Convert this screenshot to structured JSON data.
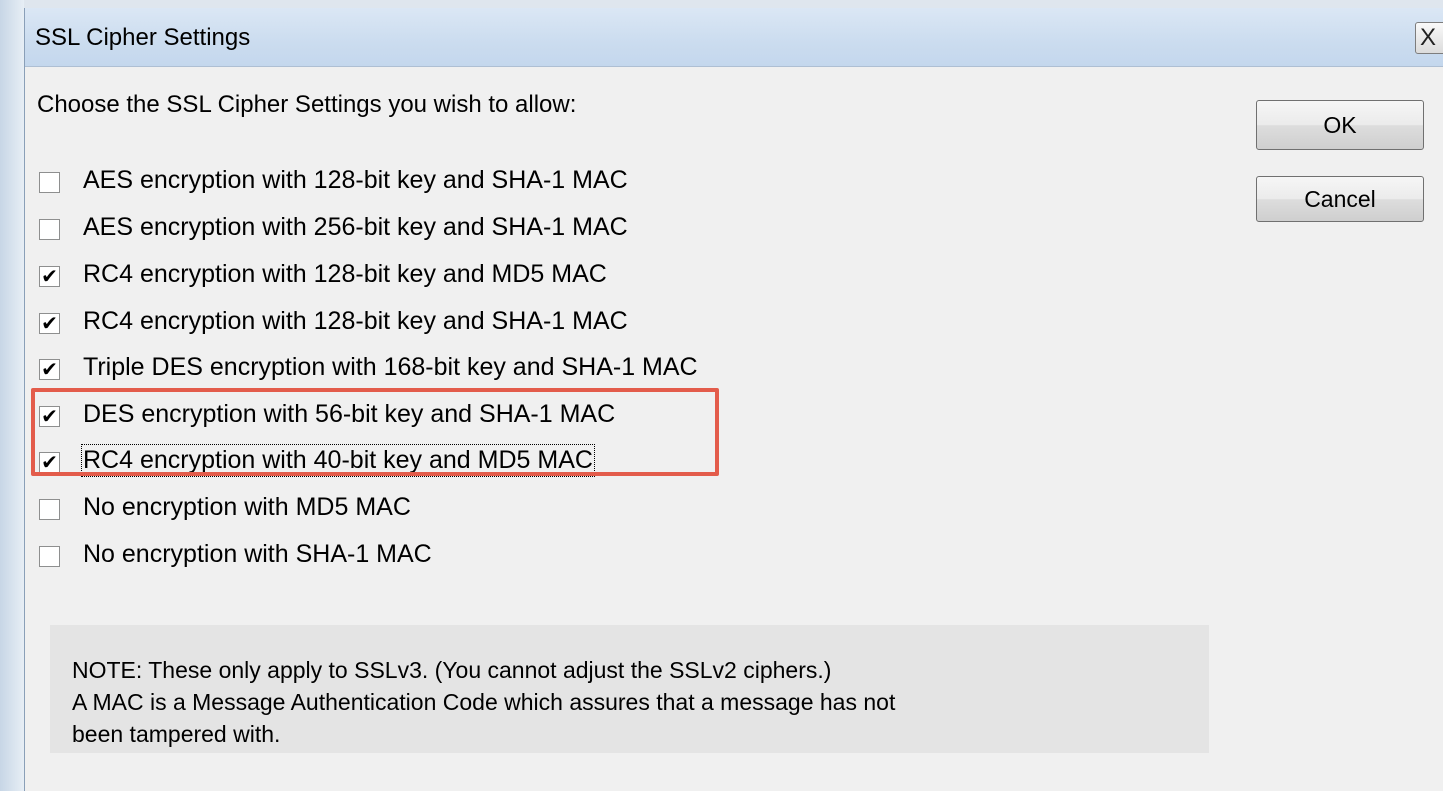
{
  "dialog": {
    "title": "SSL Cipher Settings",
    "close_glyph": "X",
    "prompt": "Choose the SSL Cipher Settings you wish to allow:",
    "ok_label": "OK",
    "cancel_label": "Cancel"
  },
  "ciphers": [
    {
      "label": "AES encryption with 128-bit key and SHA-1 MAC",
      "checked": false,
      "glyph": ""
    },
    {
      "label": "AES encryption with 256-bit key and SHA-1 MAC",
      "checked": false,
      "glyph": ""
    },
    {
      "label": "RC4 encryption with 128-bit key and MD5 MAC",
      "checked": true,
      "glyph": "✔"
    },
    {
      "label": "RC4 encryption with 128-bit key and SHA-1 MAC",
      "checked": true,
      "glyph": "✔"
    },
    {
      "label": "Triple DES encryption with 168-bit key and SHA-1 MAC",
      "checked": true,
      "glyph": "✔"
    },
    {
      "label": "DES encryption with 56-bit key and SHA-1 MAC",
      "checked": true,
      "glyph": "✔"
    },
    {
      "label": "RC4 encryption with 40-bit key and MD5 MAC",
      "checked": true,
      "glyph": "✔"
    },
    {
      "label": "No encryption with MD5 MAC",
      "checked": false,
      "glyph": ""
    },
    {
      "label": "No encryption with SHA-1 MAC",
      "checked": false,
      "glyph": ""
    }
  ],
  "note": {
    "line1": "NOTE: These only apply to SSLv3. (You cannot adjust the SSLv2 ciphers.)",
    "line2": "A MAC is a Message Authentication Code which assures that a message has not",
    "line3": "been tampered with."
  },
  "colors": {
    "highlight_border": "#e35c4b",
    "titlebar": "#cbdcef"
  }
}
